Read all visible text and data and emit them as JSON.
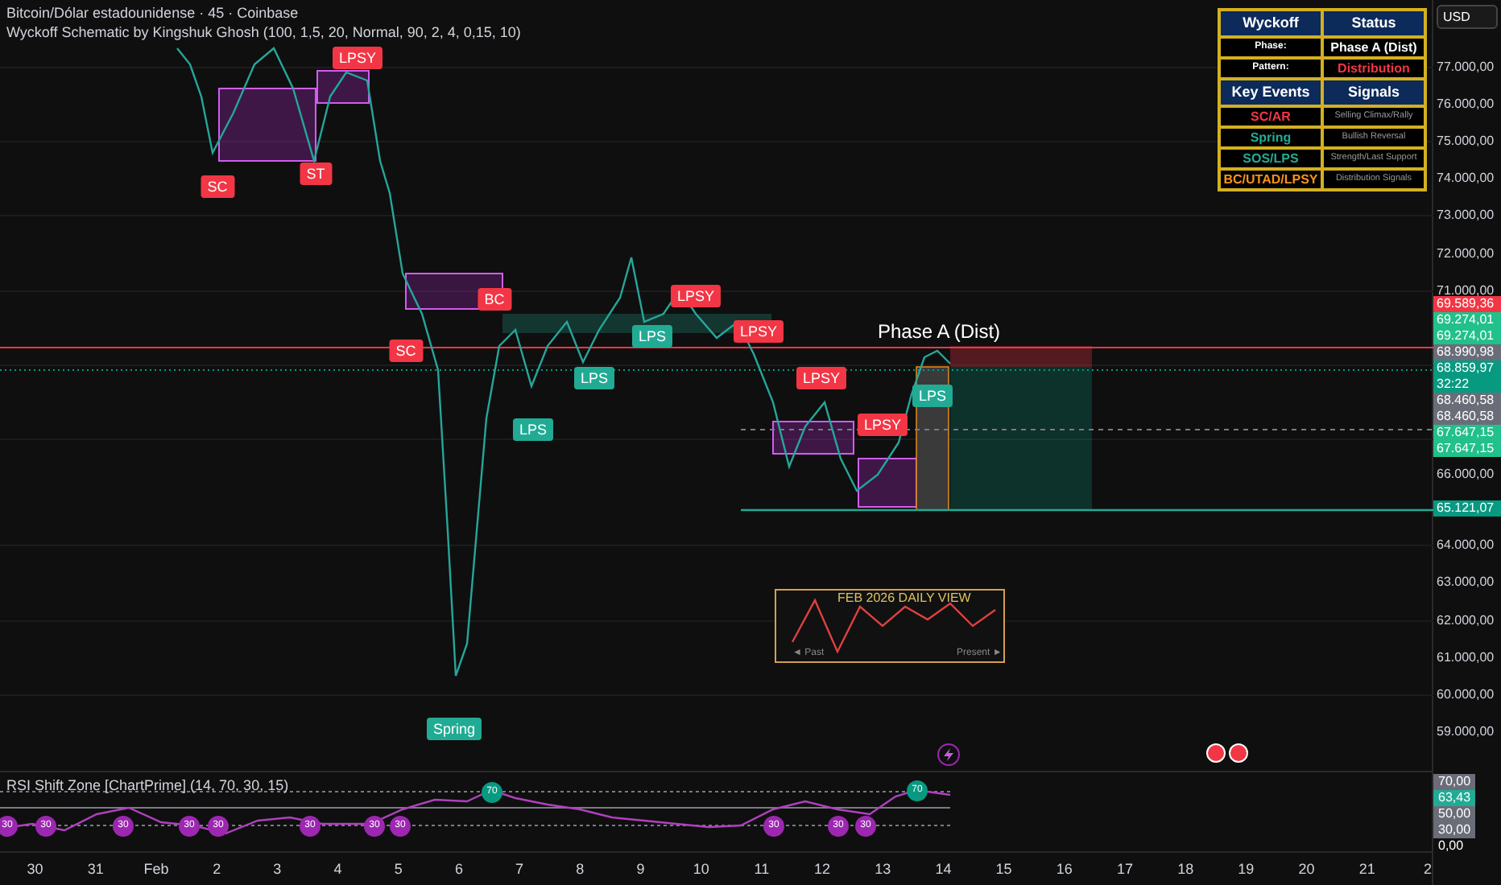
{
  "header": {
    "title": "Bitcoin/Dólar estadounidense · 45 · Coinbase",
    "indicator": "Wyckoff Schematic by Kingshuk Ghosh (100, 1,5, 20, Normal, 90, 2, 4, 0,15, 10)"
  },
  "currency_button": "USD",
  "wyckoff_table": {
    "header": [
      "Wyckoff",
      "Status"
    ],
    "status_rows": [
      {
        "label": "Phase:",
        "value": "Phase A (Dist)",
        "kind": "plain"
      },
      {
        "label": "Pattern:",
        "value": "Distribution",
        "kind": "bearish"
      }
    ],
    "events_header": [
      "Key Events",
      "Signals"
    ],
    "event_rows": [
      {
        "event": "SC/AR",
        "signal": "Selling Climax/Rally",
        "kind": "bearish"
      },
      {
        "event": "Spring",
        "signal": "Bullish Reversal",
        "kind": "bullish"
      },
      {
        "event": "SOS/LPS",
        "signal": "Strength/Last Support",
        "kind": "bullish"
      },
      {
        "event": "BC/UTAD/LPSY",
        "signal": "Distribution Signals",
        "kind": "distribution"
      }
    ]
  },
  "markers": [
    {
      "label": "LPSY",
      "kind": "bearish"
    },
    {
      "label": "SC",
      "kind": "bearish"
    },
    {
      "label": "ST",
      "kind": "bearish"
    },
    {
      "label": "SC",
      "kind": "bearish"
    },
    {
      "label": "BC",
      "kind": "bearish"
    },
    {
      "label": "LPSY",
      "kind": "bearish"
    },
    {
      "label": "LPSY",
      "kind": "bearish"
    },
    {
      "label": "LPS",
      "kind": "bullish"
    },
    {
      "label": "LPS",
      "kind": "bullish"
    },
    {
      "label": "LPS",
      "kind": "bullish"
    },
    {
      "label": "LPSY",
      "kind": "bearish"
    },
    {
      "label": "LPSY",
      "kind": "bearish"
    },
    {
      "label": "LPS",
      "kind": "bullish"
    },
    {
      "label": "Spring",
      "kind": "bullish"
    }
  ],
  "phase_label": "Phase A (Dist)",
  "inset": {
    "title": "FEB 2026 DAILY VIEW",
    "past": "◄ Past",
    "present": "Present ►"
  },
  "price_axis": {
    "ticks_upper": [
      "77.000,00",
      "76.000,00",
      "75.000,00",
      "74.000,00",
      "73.000,00",
      "72.000,00",
      "71.000,00"
    ],
    "badges": [
      {
        "value": "69.589,36",
        "color": "#f23645"
      },
      {
        "value": "69.274,01",
        "color": "#22c08a"
      },
      {
        "value": "69.274,01",
        "color": "#22c08a"
      },
      {
        "value": "68.990,98",
        "color": "#6a6d78"
      },
      {
        "value": "68.859,97",
        "color": "#089981",
        "countdown": "32:22"
      },
      {
        "value": "68.460,58",
        "color": "#6a6d78"
      },
      {
        "value": "68.460,58",
        "color": "#6a6d78"
      },
      {
        "value": "67.647,15",
        "color": "#22c08a"
      },
      {
        "value": "67.647,15",
        "color": "#22c08a"
      }
    ],
    "tick_mid": "66.000,00",
    "last_level": {
      "value": "65.121,07",
      "color": "#089981"
    },
    "ticks_lower": [
      "64.000,00",
      "63.000,00",
      "62.000,00",
      "61.000,00",
      "60.000,00",
      "59.000,00"
    ]
  },
  "rsi": {
    "title": "RSI Shift Zone [ChartPrime] (14, 70, 30, 15)",
    "markers": [
      {
        "label": "30",
        "kind": "oversold"
      },
      {
        "label": "30",
        "kind": "oversold"
      },
      {
        "label": "30",
        "kind": "oversold"
      },
      {
        "label": "30",
        "kind": "oversold"
      },
      {
        "label": "30",
        "kind": "oversold"
      },
      {
        "label": "30",
        "kind": "oversold"
      },
      {
        "label": "30",
        "kind": "oversold"
      },
      {
        "label": "30",
        "kind": "oversold"
      },
      {
        "label": "70",
        "kind": "overbought"
      },
      {
        "label": "30",
        "kind": "oversold"
      },
      {
        "label": "30",
        "kind": "oversold"
      },
      {
        "label": "30",
        "kind": "oversold"
      },
      {
        "label": "70",
        "kind": "overbought"
      }
    ],
    "axis": [
      {
        "value": "70,00",
        "color": "#6a6d78"
      },
      {
        "value": "63,43",
        "color": "#22ab94"
      },
      {
        "value": "50,00",
        "color": "#6a6d78"
      },
      {
        "value": "30,00",
        "color": "#6a6d78"
      },
      {
        "value": "0,00"
      }
    ]
  },
  "time_axis": [
    "30",
    "31",
    "Feb",
    "2",
    "3",
    "4",
    "5",
    "6",
    "7",
    "8",
    "9",
    "10",
    "11",
    "12",
    "13",
    "14",
    "15",
    "16",
    "17",
    "18",
    "19",
    "20",
    "21",
    "2"
  ]
}
